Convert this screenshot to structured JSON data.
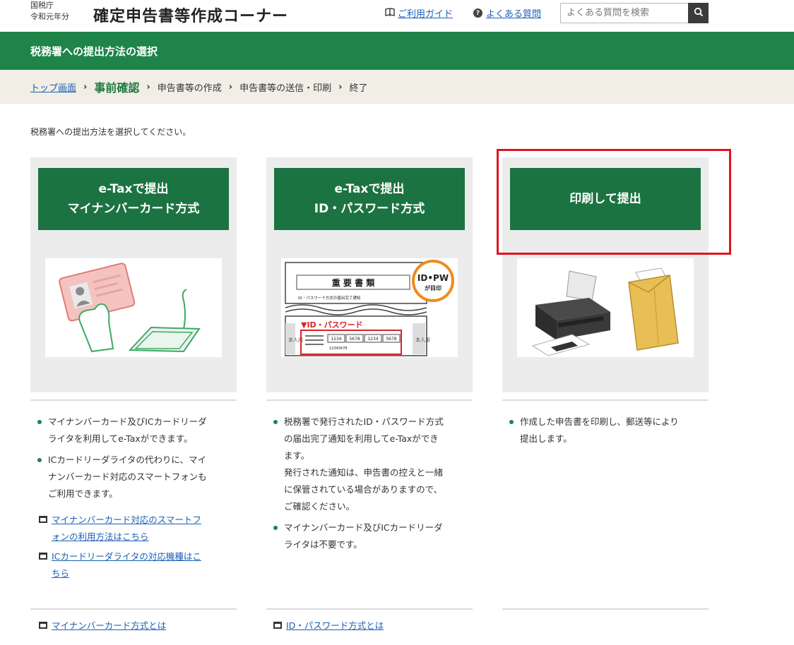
{
  "header": {
    "agency": "国税庁",
    "year": "令和元年分",
    "title": "確定申告書等作成コーナー",
    "guide_link": "ご利用ガイド",
    "faq_link": "よくある質問",
    "search_placeholder": "よくある質問を検索"
  },
  "page_title": "税務署への提出方法の選択",
  "breadcrumb": {
    "top": "トップ画面",
    "current": "事前確認",
    "step3": "申告書等の作成",
    "step4": "申告書等の送信・印刷",
    "step5": "終了"
  },
  "instruction": "税務署への提出方法を選択してください。",
  "options": [
    {
      "title_line1": "e-Taxで提出",
      "title_line2": "マイナンバーカード方式",
      "bullets": [
        "マイナンバーカード及びICカードリーダ\nライタを利用してe-Taxができます。",
        "ICカードリーダライタの代わりに、マイ\nナンバーカード対応のスマートフォンも\nご利用できます。"
      ],
      "links": [
        "マイナンバーカード対応のスマートフ\nォンの利用方法はこちら",
        "ICカードリーダライタの対応機種はこ\nちら"
      ],
      "footer_link": "マイナンバーカード方式とは"
    },
    {
      "title_line1": "e-Taxで提出",
      "title_line2": "ID・パスワード方式",
      "illustration": {
        "doc_title": "重 要 書 類",
        "doc_caption": "ID・パスワード方式の届出完了通知",
        "badge_main": "ID•PW",
        "badge_sub": "が目印",
        "label": "▼ID・パスワード",
        "side_text": "本人用",
        "id_groups": [
          "1234",
          "5678",
          "1234",
          "5678"
        ],
        "id_sub": "12345678"
      },
      "bullets": [
        "税務署で発行されたID・パスワード方式\nの届出完了通知を利用してe-Taxができ\nます。\n発行された通知は、申告書の控えと一緒\nに保管されている場合がありますので、\nご確認ください。",
        "マイナンバーカード及びICカードリーダ\nライタは不要です。"
      ],
      "footer_link": "ID・パスワード方式とは"
    },
    {
      "title_line1": "印刷して提出",
      "bullets": [
        "作成した申告書を印刷し、郵送等により\n提出します。"
      ]
    }
  ],
  "colors": {
    "brand_green": "#1e8449",
    "button_green": "#1c7342",
    "highlight_red": "#e0141e",
    "breadcrumb_bg": "#f1eee6"
  }
}
